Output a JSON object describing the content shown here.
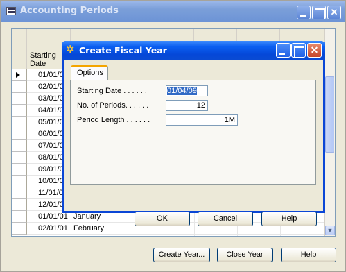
{
  "outer_window": {
    "title": "Accounting Periods",
    "header": {
      "starting_date_line1": "Starting",
      "starting_date_line2": "Date"
    },
    "rows": [
      {
        "date": "01/01/0",
        "name": "",
        "check": ""
      },
      {
        "date": "02/01/0",
        "name": "",
        "check": ""
      },
      {
        "date": "03/01/0",
        "name": "",
        "check": ""
      },
      {
        "date": "04/01/0",
        "name": "",
        "check": ""
      },
      {
        "date": "05/01/0",
        "name": "",
        "check": ""
      },
      {
        "date": "06/01/0",
        "name": "",
        "check": ""
      },
      {
        "date": "07/01/0",
        "name": "",
        "check": ""
      },
      {
        "date": "08/01/0",
        "name": "",
        "check": ""
      },
      {
        "date": "09/01/0",
        "name": "",
        "check": ""
      },
      {
        "date": "10/01/0",
        "name": "",
        "check": ""
      },
      {
        "date": "11/01/0",
        "name": "",
        "check": ""
      },
      {
        "date": "12/01/0",
        "name": "",
        "check": ""
      },
      {
        "date": "01/01/01",
        "name": "January",
        "check": "✔"
      },
      {
        "date": "02/01/01",
        "name": "February",
        "check": ""
      }
    ],
    "buttons": {
      "create_year": "Create Year...",
      "close_year": "Close Year",
      "help": "Help"
    }
  },
  "dialog": {
    "title": "Create Fiscal Year",
    "tab_label": "Options",
    "fields": {
      "starting_date_label": "Starting Date . . . . . .",
      "starting_date_value": "01/04/09",
      "no_of_periods_label": "No. of Periods. . . . . .",
      "no_of_periods_value": "12",
      "period_length_label": "Period Length . . . . . .",
      "period_length_value": "1M"
    },
    "buttons": {
      "ok": "OK",
      "cancel": "Cancel",
      "help": "Help"
    }
  },
  "colors": {
    "dialog_title_blue": "#0a5ef0",
    "selection_blue": "#316ac5",
    "tab_accent": "#f4a500"
  }
}
